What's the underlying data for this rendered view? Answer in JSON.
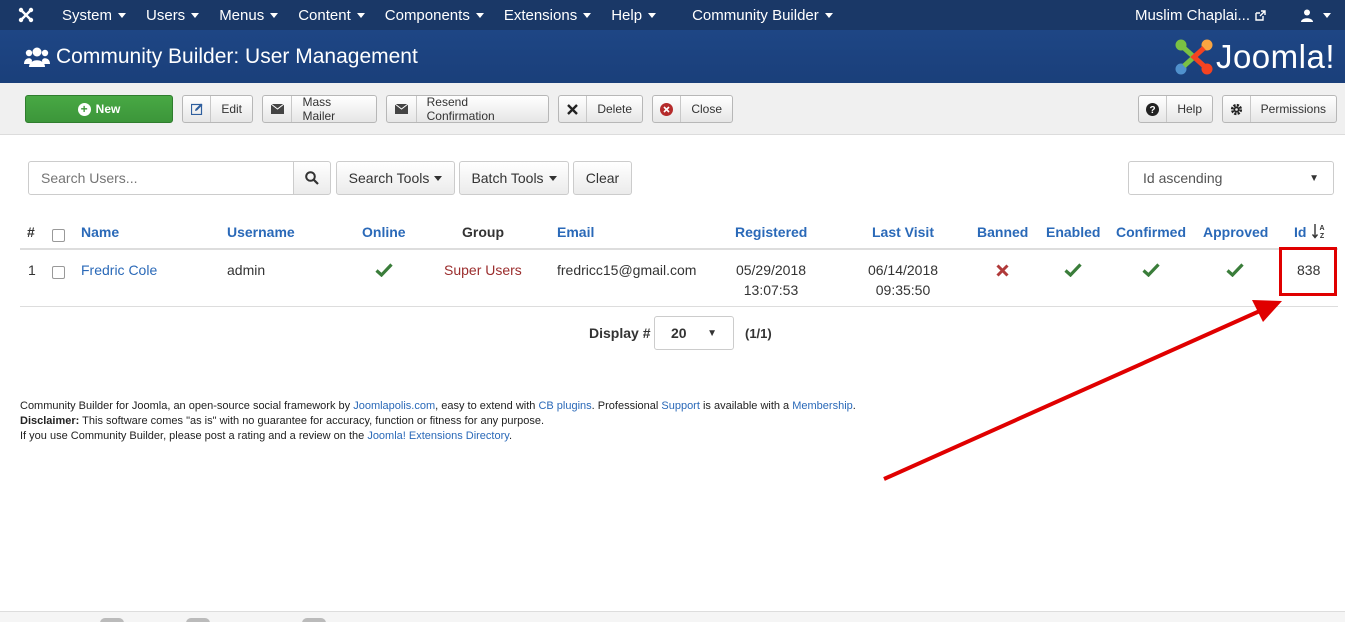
{
  "nav": {
    "menus": [
      "System",
      "Users",
      "Menus",
      "Content",
      "Components",
      "Extensions",
      "Help"
    ],
    "community_builder": "Community Builder",
    "user_name": "Muslim Chaplai..."
  },
  "header": {
    "title": "Community Builder: User Management",
    "logo_text": "Joomla!"
  },
  "toolbar": {
    "new": "New",
    "edit": "Edit",
    "mass_mailer": "Mass Mailer",
    "resend": "Resend Confirmation",
    "delete": "Delete",
    "close": "Close",
    "help": "Help",
    "permissions": "Permissions"
  },
  "filters": {
    "search_placeholder": "Search Users...",
    "search_tools": "Search Tools",
    "batch_tools": "Batch Tools",
    "clear": "Clear",
    "sort_value": "Id ascending"
  },
  "table": {
    "headers": {
      "num": "#",
      "name": "Name",
      "username": "Username",
      "online": "Online",
      "group": "Group",
      "email": "Email",
      "registered": "Registered",
      "last_visit": "Last Visit",
      "banned": "Banned",
      "enabled": "Enabled",
      "confirmed": "Confirmed",
      "approved": "Approved",
      "id": "Id"
    },
    "rows": [
      {
        "num": "1",
        "name": "Fredric Cole",
        "username": "admin",
        "group": "Super Users",
        "email": "fredricc15@gmail.com",
        "registered_date": "05/29/2018",
        "registered_time": "13:07:53",
        "last_visit_date": "06/14/2018",
        "last_visit_time": "09:35:50",
        "id": "838"
      }
    ]
  },
  "pagination": {
    "display_label": "Display #",
    "limit": "20",
    "pages": "(1/1)"
  },
  "footer": {
    "line1_a": "Community Builder for Joomla, an open-source social framework by ",
    "link_joomlapolis": "Joomlapolis.com",
    "line1_b": ", easy to extend with ",
    "link_cb_plugins": "CB plugins",
    "line1_c": ". Professional ",
    "link_support": "Support",
    "line1_d": " is available with a ",
    "link_membership": "Membership",
    "line1_e": ".",
    "disclaimer_label": "Disclaimer:",
    "disclaimer_text": " This software comes \"as is\" with no guarantee for accuracy, function or fitness for any purpose.",
    "line3_a": "If you use Community Builder, please post a rating and a review on the ",
    "link_jed": "Joomla! Extensions Directory",
    "line3_b": "."
  },
  "colors": {
    "navbar": "#1a3867",
    "header": "#1e4685",
    "new_button": "#3c963a",
    "link": "#2a69b8",
    "check": "#3a7d3a",
    "cross": "#b03a3a",
    "annotation": "#e00000"
  }
}
